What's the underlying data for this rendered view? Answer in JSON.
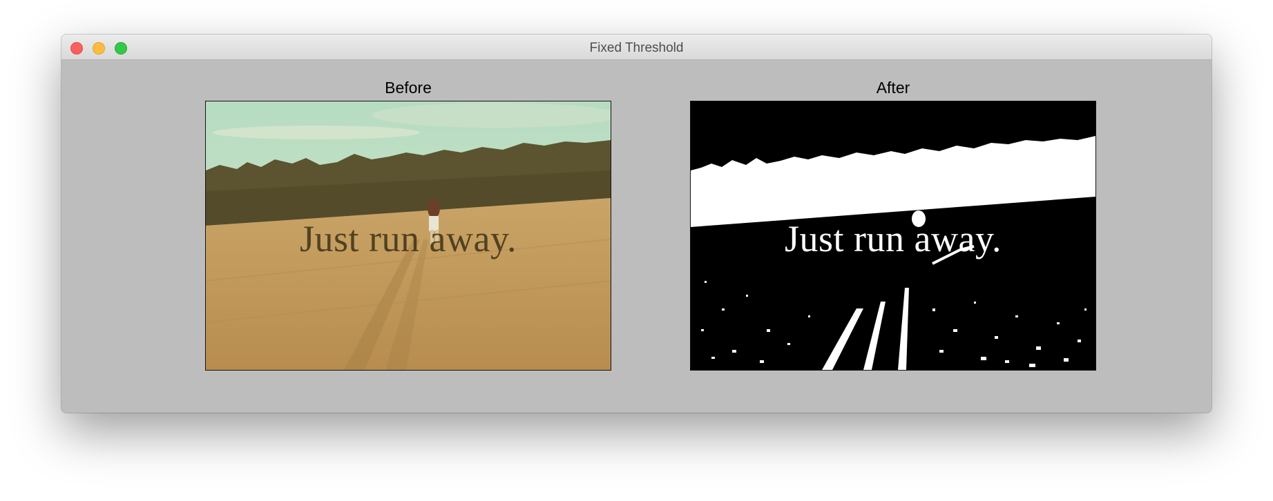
{
  "window": {
    "title": "Fixed Threshold"
  },
  "panels": {
    "before": {
      "label": "Before",
      "caption": "Just run  away."
    },
    "after": {
      "label": "After",
      "caption": "Just run  away."
    }
  },
  "colors": {
    "window_bg": "#bdbdbd",
    "close": "#fc605c",
    "minimize": "#fdbc40",
    "maximize": "#34c84a"
  }
}
